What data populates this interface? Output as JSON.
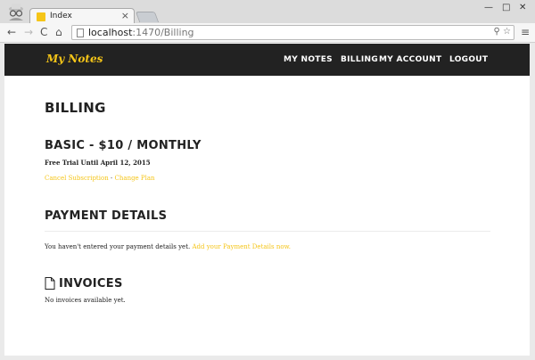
{
  "browser": {
    "tab_title": "Index",
    "tab_close": "×",
    "url_host": "localhost",
    "url_path": ":1470/Billing",
    "window_controls": {
      "minimize": "—",
      "maximize": "□",
      "close": "✕"
    },
    "nav_icons": {
      "back": "←",
      "forward": "→",
      "reload": "C",
      "home": "⌂",
      "menu": "≡",
      "omni": "⚲ ☆"
    }
  },
  "navbar": {
    "brand": "My Notes",
    "links": [
      "MY NOTES",
      "BILLING",
      "MY ACCOUNT",
      "LOGOUT"
    ]
  },
  "page": {
    "title": "BILLING",
    "plan": {
      "title": "BASIC - $10 / MONTHLY",
      "trial": "Free Trial Until April 12, 2015",
      "cancel_link": "Cancel Subscription",
      "separator": " - ",
      "change_link": "Change Plan"
    },
    "payment": {
      "title": "PAYMENT DETAILS",
      "text": "You haven't entered your payment details yet. ",
      "link": "Add your Payment Details now."
    },
    "invoices": {
      "title": "INVOICES",
      "text": "No invoices available yet."
    }
  },
  "colors": {
    "accent": "#f5c518",
    "navbar_bg": "#222222"
  }
}
